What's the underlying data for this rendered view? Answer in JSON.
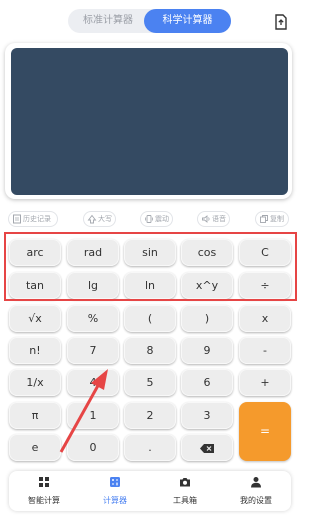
{
  "mode_switch": {
    "standard_label": "标准计算器",
    "scientific_label": "科学计算器",
    "selected": "科学计算器"
  },
  "display": {
    "expression": "",
    "result": ""
  },
  "toolbar": {
    "history_label": "历史记录",
    "uppercase_label": "大写",
    "vibrate_label": "震动",
    "voice_label": "语音",
    "copy_label": "复制"
  },
  "keypad": {
    "row1": [
      "arc",
      "rad",
      "sin",
      "cos",
      "C"
    ],
    "row2": [
      "tan",
      "lg",
      "ln",
      "x^y",
      "÷"
    ],
    "row3": [
      "√x",
      "%",
      "(",
      ")",
      "x"
    ],
    "row4": [
      "n!",
      "7",
      "8",
      "9",
      "-"
    ],
    "row5": [
      "1/x",
      "4",
      "5",
      "6",
      "+"
    ],
    "row6": [
      "π",
      "1",
      "2",
      "3"
    ],
    "row7": [
      "e",
      "0",
      "."
    ],
    "equals": "="
  },
  "bottom_nav": {
    "items": [
      {
        "label": "智能计算"
      },
      {
        "label": "计算器"
      },
      {
        "label": "工具箱"
      },
      {
        "label": "我的设置"
      }
    ],
    "active": "计算器"
  },
  "colors": {
    "accent": "#4b82f1",
    "display_bg": "#344a62",
    "equals_bg": "#f59a2c",
    "highlight": "#e64545"
  }
}
